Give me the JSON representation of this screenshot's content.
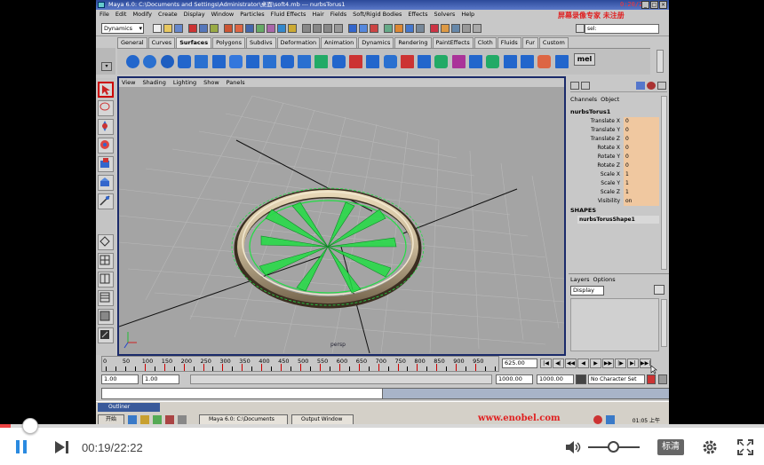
{
  "window": {
    "title": "Maya 6.0: C:\\Documents and Settings\\Administrator\\桌面\\soft4.mb  ---  nurbsTorus1",
    "overlay_time": "0:20/22:22"
  },
  "menubar": [
    "File",
    "Edit",
    "Modify",
    "Create",
    "Display",
    "Window",
    "Particles",
    "Fluid Effects",
    "Hair",
    "Fields",
    "Soft/Rigid Bodies",
    "Effects",
    "Solvers",
    "Help"
  ],
  "watermark_top": "屏幕录像专家 未注册",
  "statusline": {
    "mode": "Dynamics",
    "sel_label": "sel:"
  },
  "shelf_tabs": [
    "General",
    "Curves",
    "Surfaces",
    "Polygons",
    "Subdivs",
    "Deformation",
    "Animation",
    "Dynamics",
    "Rendering",
    "PaintEffects",
    "Cloth",
    "Fluids",
    "Fur",
    "Custom"
  ],
  "shelf_active_tab": "Surfaces",
  "shelf_mel_label": "mel",
  "viewport": {
    "menu": [
      "View",
      "Shading",
      "Lighting",
      "Show",
      "Panels"
    ],
    "camera_label": "persp"
  },
  "channelbox": {
    "tabs": [
      "Channels",
      "Object"
    ],
    "object": "nurbsTorus1",
    "attributes": [
      {
        "name": "Translate X",
        "value": "0"
      },
      {
        "name": "Translate Y",
        "value": "0"
      },
      {
        "name": "Translate Z",
        "value": "0"
      },
      {
        "name": "Rotate X",
        "value": "0"
      },
      {
        "name": "Rotate Y",
        "value": "0"
      },
      {
        "name": "Rotate Z",
        "value": "0"
      },
      {
        "name": "Scale X",
        "value": "1"
      },
      {
        "name": "Scale Y",
        "value": "1"
      },
      {
        "name": "Scale Z",
        "value": "1"
      },
      {
        "name": "Visibility",
        "value": "on"
      }
    ],
    "shapes_header": "SHAPES",
    "shape_name": "nurbsTorusShape1"
  },
  "layers": {
    "menu": [
      "Layers",
      "Options"
    ],
    "display": "Display"
  },
  "timeline": {
    "ticks": [
      "0",
      "50",
      "100",
      "150",
      "200",
      "250",
      "300",
      "350",
      "400",
      "450",
      "500",
      "550",
      "600",
      "650",
      "700",
      "750",
      "800",
      "850",
      "900",
      "950"
    ],
    "current_frame": "625.00",
    "range_start": "1.00",
    "range_start2": "1.00",
    "range_end": "1000.00",
    "range_end2": "1000.00",
    "character_set": "No Character Set"
  },
  "taskbar": {
    "outliner": "Outliner",
    "start": "开始",
    "items": [
      "Maya 6.0: C:\\Documents",
      "Output Window"
    ],
    "watermark": "www.enobel.com",
    "clock": "01:05 上午"
  },
  "player": {
    "progress": 0.0143,
    "time": "00:19/22:22",
    "volume": 0.4,
    "quality": "标清"
  },
  "colors": {
    "accent": "#e44444",
    "play_blue": "#2a8ae0",
    "nurbs_green": "#22dd44",
    "attr_bg": "#f0c8a0"
  }
}
